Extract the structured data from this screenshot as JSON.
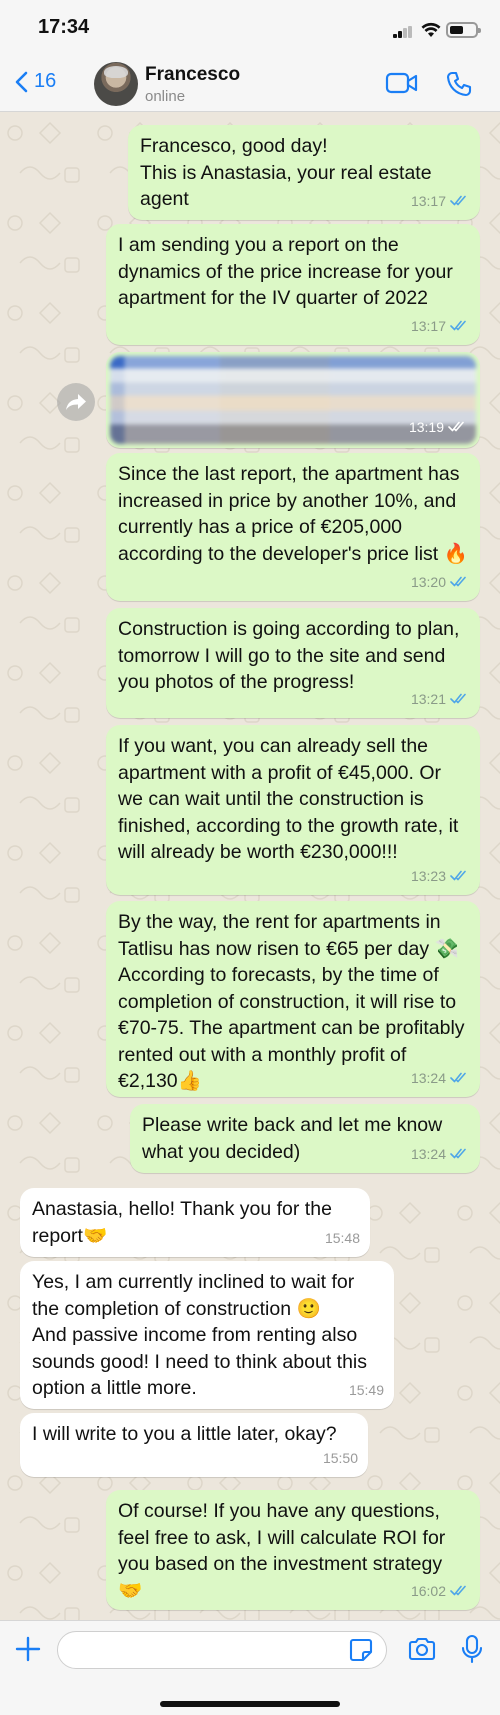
{
  "status_bar": {
    "time": "17:34"
  },
  "header": {
    "back_count": "16",
    "contact_name": "Francesco",
    "contact_status": "online"
  },
  "messages": [
    {
      "dir": "out",
      "text": "Francesco, good day!\nThis is Anastasia, your real estate agent",
      "time": "13:17",
      "read": true
    },
    {
      "dir": "out",
      "text": "I am sending you a report on the dynamics of the price increase for your apartment for the IV quarter of 2022",
      "time": "13:17",
      "read": true
    },
    {
      "dir": "out",
      "type": "image",
      "time": "13:19",
      "read": true
    },
    {
      "dir": "out",
      "text": "Since the last report, the apartment has increased in price by another 10%, and currently has a price of €205,000 according to the developer's price list 🔥",
      "time": "13:20",
      "read": true
    },
    {
      "dir": "out",
      "text": "Construction is going according to plan, tomorrow I will go to the site and send you photos of the progress!",
      "time": "13:21",
      "read": true
    },
    {
      "dir": "out",
      "text": "If you want, you can already sell the apartment with a profit of €45,000. Or we can wait until the construction is finished, according to the growth rate, it will already be worth €230,000!!!",
      "time": "13:23",
      "read": true
    },
    {
      "dir": "out",
      "text": "By the way, the rent for apartments in Tatlisu has now risen to €65 per day 💸 According to forecasts, by the time of completion of construction, it will rise to €70-75. The apartment can be profitably rented out with a monthly profit of €2,130👍",
      "time": "13:24",
      "read": true
    },
    {
      "dir": "out",
      "text": "Please write back and let me know what you decided)",
      "time": "13:24",
      "read": true
    },
    {
      "dir": "in",
      "text": "Anastasia, hello! Thank you for the report🤝",
      "time": "15:48"
    },
    {
      "dir": "in",
      "text": "Yes, I am currently inclined to wait for the completion of construction 🙂\nAnd passive income from renting also sounds good! I need to think about this option a little more.",
      "time": "15:49"
    },
    {
      "dir": "in",
      "text": "I will write to you a little later, okay?",
      "time": "15:50"
    },
    {
      "dir": "out",
      "text": "Of course! If you have any questions, feel free to ask, I will calculate ROI for you based on the investment strategy 🤝",
      "time": "16:02",
      "read": true
    }
  ],
  "input": {
    "value": "",
    "placeholder": ""
  },
  "icons": {
    "back": "chevron-left-icon",
    "video": "video-camera-icon",
    "call": "phone-icon",
    "plus": "plus-icon",
    "sticker": "sticker-icon",
    "camera": "camera-icon",
    "mic": "microphone-icon",
    "forward": "forward-icon",
    "read": "double-check-icon"
  },
  "colors": {
    "accent": "#1a7ef5",
    "outgoing_bubble": "#dcf8c6",
    "incoming_bubble": "#ffffff",
    "chat_bg": "#ece6dc",
    "read_tick": "#4fa6e8"
  }
}
